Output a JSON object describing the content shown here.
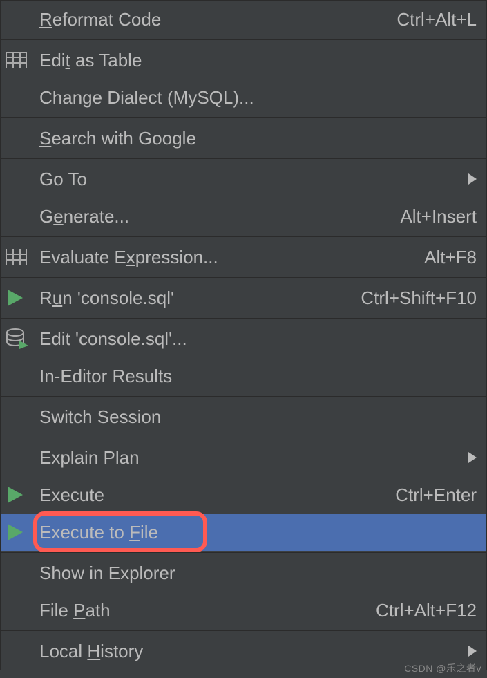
{
  "menu": {
    "items": [
      {
        "label_pre": "",
        "mnemonic": "R",
        "label_post": "eformat Code",
        "shortcut": "Ctrl+Alt+L",
        "icon": "",
        "submenu": false
      },
      {
        "separator": true
      },
      {
        "label_pre": "Edi",
        "mnemonic": "t",
        "label_post": " as Table",
        "shortcut": "",
        "icon": "table",
        "submenu": false
      },
      {
        "label_pre": "Change Dialect (MySQL)...",
        "mnemonic": "",
        "label_post": "",
        "shortcut": "",
        "icon": "",
        "submenu": false
      },
      {
        "separator": true
      },
      {
        "label_pre": "",
        "mnemonic": "S",
        "label_post": "earch with Google",
        "shortcut": "",
        "icon": "",
        "submenu": false
      },
      {
        "separator": true
      },
      {
        "label_pre": "Go To",
        "mnemonic": "",
        "label_post": "",
        "shortcut": "",
        "icon": "",
        "submenu": true
      },
      {
        "label_pre": "G",
        "mnemonic": "e",
        "label_post": "nerate...",
        "shortcut": "Alt+Insert",
        "icon": "",
        "submenu": false
      },
      {
        "separator": true
      },
      {
        "label_pre": "Evaluate E",
        "mnemonic": "x",
        "label_post": "pression...",
        "shortcut": "Alt+F8",
        "icon": "table",
        "submenu": false
      },
      {
        "separator": true
      },
      {
        "label_pre": "R",
        "mnemonic": "u",
        "label_post": "n 'console.sql'",
        "shortcut": "Ctrl+Shift+F10",
        "icon": "play",
        "submenu": false
      },
      {
        "separator": true
      },
      {
        "label_pre": "Edit 'console.sql'...",
        "mnemonic": "",
        "label_post": "",
        "shortcut": "",
        "icon": "db-edit",
        "submenu": false
      },
      {
        "label_pre": "In-Editor Results",
        "mnemonic": "",
        "label_post": "",
        "shortcut": "",
        "icon": "",
        "submenu": false
      },
      {
        "separator": true
      },
      {
        "label_pre": "Switch Session",
        "mnemonic": "",
        "label_post": "",
        "shortcut": "",
        "icon": "",
        "submenu": false
      },
      {
        "separator": true
      },
      {
        "label_pre": "Explain Plan",
        "mnemonic": "",
        "label_post": "",
        "shortcut": "",
        "icon": "",
        "submenu": true
      },
      {
        "label_pre": "Execute",
        "mnemonic": "",
        "label_post": "",
        "shortcut": "Ctrl+Enter",
        "icon": "play",
        "submenu": false
      },
      {
        "label_pre": "Execute to ",
        "mnemonic": "F",
        "label_post": "ile",
        "shortcut": "",
        "icon": "play",
        "submenu": false,
        "selected": true,
        "highlighted": true
      },
      {
        "separator": true
      },
      {
        "label_pre": "Show in Explorer",
        "mnemonic": "",
        "label_post": "",
        "shortcut": "",
        "icon": "",
        "submenu": false
      },
      {
        "label_pre": "File ",
        "mnemonic": "P",
        "label_post": "ath",
        "shortcut": "Ctrl+Alt+F12",
        "icon": "",
        "submenu": false
      },
      {
        "separator": true
      },
      {
        "label_pre": "Local ",
        "mnemonic": "H",
        "label_post": "istory",
        "shortcut": "",
        "icon": "",
        "submenu": true
      }
    ]
  },
  "watermark": "CSDN @乐之者v"
}
